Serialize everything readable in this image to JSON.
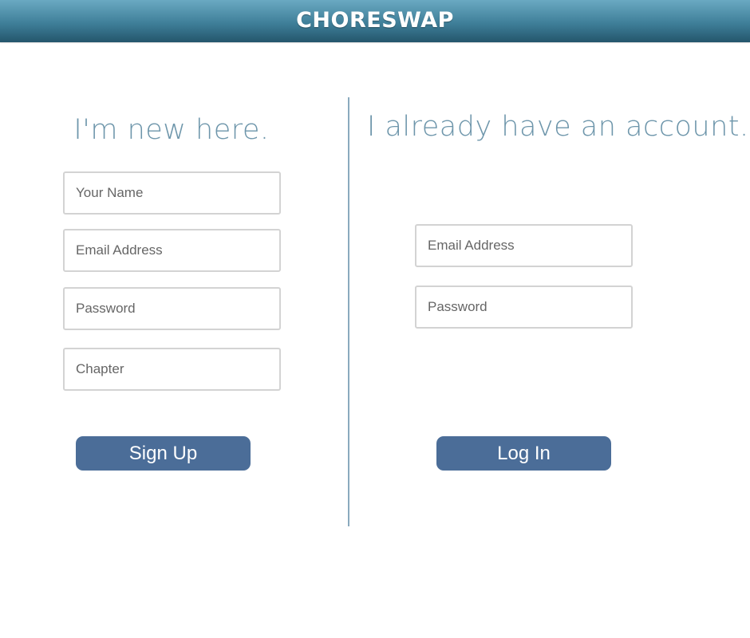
{
  "header": {
    "brand": "CHORESWAP",
    "background_color": "#3f7f99"
  },
  "signup": {
    "heading": "I'm new here.",
    "name_placeholder": "Your Name",
    "email_placeholder": "Email Address",
    "password_placeholder": "Password",
    "chapter_placeholder": "Chapter",
    "button_label": "Sign Up"
  },
  "login": {
    "heading": "I already have an account.",
    "email_placeholder": "Email Address",
    "password_placeholder": "Password",
    "button_label": "Log In"
  },
  "colors": {
    "heading": "#6e96ab",
    "button": "#4b6d98",
    "divider": "#8aaabe"
  }
}
